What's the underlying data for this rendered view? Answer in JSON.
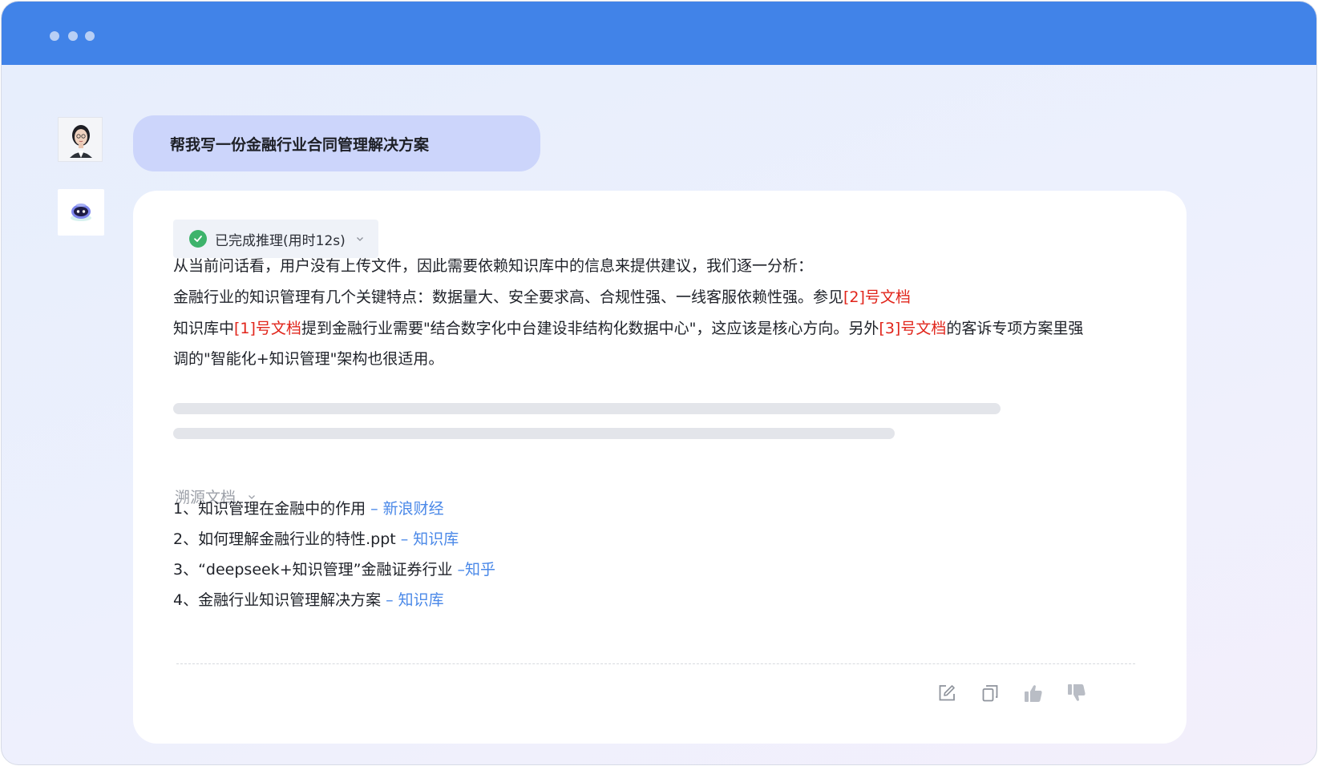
{
  "window": {
    "colors": {
      "titlebar": "#4183e8",
      "reference_link": "#e1251b",
      "source_tag": "#4a88e8",
      "status_check": "#3db36b"
    }
  },
  "chat": {
    "user_message": "帮我写一份金融行业合同管理解决方案",
    "status": {
      "label": "已完成推理(用时12s)",
      "icon": "check-circle-icon",
      "toggle_icon": "chevron-down-icon"
    },
    "analysis": {
      "line1": "从当前问话看，用户没有上传文件，因此需要依赖知识库中的信息来提供建议，我们逐一分析：",
      "line2_text": "金融行业的知识管理有几个关键特点：数据量大、安全要求高、合规性强、一线客服依赖性强。参见",
      "line2_ref": "[2]号文档",
      "line3_a": "知识库中",
      "line3_ref1": "[1]号文档",
      "line3_b": "提到金融行业需要\"结合数字化中台建设非结构化数据中心\"，这应该是核心方向。另外",
      "line3_ref2": "[3]号文档",
      "line3_c": "的客诉专项方案里强",
      "line4": "调的\"智能化+知识管理\"架构也很适用。"
    },
    "sources": {
      "title": "溯源文档",
      "items": [
        {
          "label": "1、知识管理在金融中的作用",
          "source": " – 新浪财经"
        },
        {
          "label": "2、如何理解金融行业的特性.ppt",
          "source": " – 知识库"
        },
        {
          "label": "3、“deepseek+知识管理”金融证券行业",
          "source": " –知乎"
        },
        {
          "label": "4、金融行业知识管理解决方案",
          "source": " – 知识库"
        }
      ]
    },
    "actions": [
      "edit-icon",
      "copy-icon",
      "thumbs-up-icon",
      "thumbs-down-icon"
    ]
  }
}
